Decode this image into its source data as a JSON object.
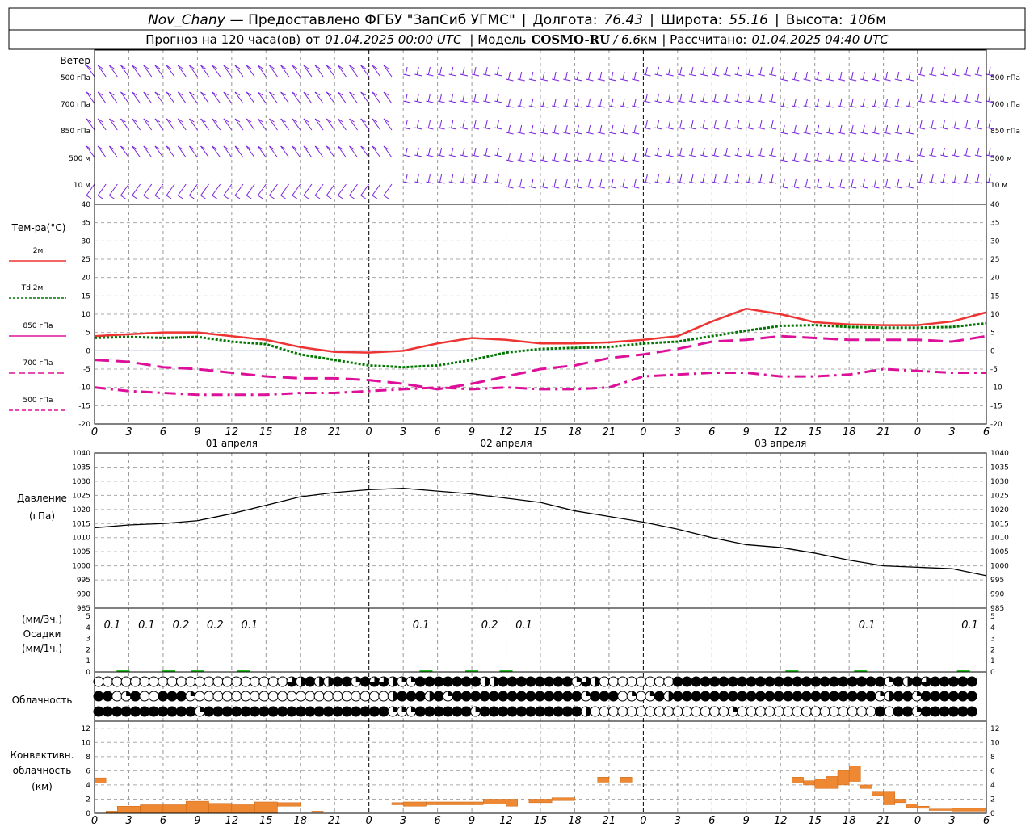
{
  "header": {
    "station": "Nov_Chany",
    "provider": "— Предоставлено ФГБУ \"ЗапСиб УГМС\"",
    "lon_label": "Долгота:",
    "lon_value": "76.43",
    "lat_label": "Широта:",
    "lat_value": "55.16",
    "alt_label": "Высота:",
    "alt_value": "106",
    "alt_unit": "м",
    "forecast_text": "Прогноз на 120 часа(ов)",
    "from_text": "от",
    "forecast_start": "01.04.2025 00:00 UTC",
    "model_label": "| Модель",
    "model_name": "COSMO-RU",
    "model_res": "/ 6.6",
    "model_res_unit": "км",
    "calc_label": "| Рассчитано:",
    "calc_time": "01.04.2025 04:40 UTC"
  },
  "x_axis": {
    "hour_labels": [
      "0",
      "3",
      "6",
      "9",
      "12",
      "15",
      "18",
      "21",
      "0",
      "3",
      "6",
      "9",
      "12",
      "15",
      "18",
      "21",
      "0",
      "3",
      "6",
      "9",
      "12",
      "15",
      "18",
      "21",
      "0",
      "3",
      "6"
    ],
    "day_labels": [
      "01 апреля",
      "02 апреля",
      "03 апреля"
    ]
  },
  "wind_panel": {
    "title": "Ветер",
    "levels": [
      "500 гПа",
      "700 гПа",
      "850 гПа",
      "500  м",
      "10   м"
    ]
  },
  "temperature_panel": {
    "title": "Тем-ра(°C)",
    "legend": [
      {
        "label": "2м",
        "color": "#ee3333",
        "style": "solid"
      },
      {
        "label": "Td  2м",
        "color": "#007700",
        "style": "dotted"
      },
      {
        "label": "850 гПа",
        "color": "#dd1199",
        "style": "long-dash"
      },
      {
        "label": "700 гПа",
        "color": "#dd1199",
        "style": "dash"
      },
      {
        "label": "500 гПа",
        "color": "#dd1199",
        "style": "dash-dot"
      }
    ],
    "y_ticks": [
      "40",
      "35",
      "30",
      "25",
      "20",
      "15",
      "10",
      "5",
      "0",
      "-5",
      "-10",
      "-15",
      "-20"
    ]
  },
  "pressure_panel": {
    "title": "Давление",
    "unit": "(гПа)",
    "y_ticks": [
      "1040",
      "1035",
      "1030",
      "1025",
      "1020",
      "1015",
      "1010",
      "1005",
      "1000",
      "995",
      "990",
      "985"
    ]
  },
  "precip_panel": {
    "unit_top": "(мм/3ч.)",
    "title": "Осадки",
    "unit_bottom": "(мм/1ч.)",
    "y_ticks": [
      "5",
      "4",
      "3",
      "2",
      "1",
      "0"
    ],
    "annotations": [
      {
        "hour": 0,
        "text": "0.1"
      },
      {
        "hour": 3,
        "text": "0.1"
      },
      {
        "hour": 6,
        "text": "0.2"
      },
      {
        "hour": 9,
        "text": "0.2"
      },
      {
        "hour": 12,
        "text": "0.1"
      },
      {
        "hour": 27,
        "text": "0.1"
      },
      {
        "hour": 33,
        "text": "0.2"
      },
      {
        "hour": 36,
        "text": "0.1"
      },
      {
        "hour": 66,
        "text": "0.1"
      },
      {
        "hour": 75,
        "text": "0.1"
      }
    ]
  },
  "cloud_panel": {
    "title": "Облачность"
  },
  "conv_panel": {
    "title_1": "Конвективн.",
    "title_2": "облачность",
    "unit": "(км)",
    "y_ticks": [
      "12",
      "10",
      "8",
      "6",
      "4",
      "2",
      "0"
    ]
  },
  "chart_data": {
    "type": "line",
    "x_unit": "hours from 01.04.2025 00:00 UTC",
    "x_range": [
      0,
      78
    ],
    "x": [
      0,
      3,
      6,
      9,
      12,
      15,
      18,
      21,
      24,
      27,
      30,
      33,
      36,
      39,
      42,
      45,
      48,
      51,
      54,
      57,
      60,
      63,
      66,
      69,
      72,
      75,
      78
    ],
    "temperature": {
      "ylim": [
        -20,
        40
      ],
      "series": [
        {
          "name": "2м",
          "values": [
            4,
            4.5,
            5,
            5,
            4,
            3,
            1,
            -0.3,
            -0.5,
            0,
            2,
            3.5,
            3,
            2,
            2,
            2.3,
            3,
            4,
            8,
            11.5,
            10,
            7.8,
            7.2,
            7,
            7,
            8,
            10.5
          ]
        },
        {
          "name": "Td  2м",
          "values": [
            3.5,
            3.8,
            3.5,
            3.8,
            2.5,
            1.8,
            -1,
            -2.5,
            -4,
            -4.5,
            -4,
            -2.5,
            -0.5,
            0.5,
            0.8,
            1,
            2,
            2.5,
            4,
            5.5,
            6.8,
            7,
            6.5,
            6.3,
            6.3,
            6.5,
            7.5
          ]
        },
        {
          "name": "850 гПа",
          "values": [
            -2.5,
            -3,
            -4.5,
            -5,
            -6,
            -7,
            -7.5,
            -7.5,
            -8,
            -9,
            -10.5,
            -9,
            -7,
            -5,
            -4,
            -2,
            -1,
            0.5,
            2.5,
            3,
            4,
            3.5,
            3,
            3,
            3,
            2.5,
            4
          ]
        },
        {
          "name": "700 гПа",
          "values": [
            -10,
            -11,
            -11.5,
            -12,
            -12,
            -12,
            -11.5,
            -11.5,
            -11,
            -10.5,
            -10,
            -10.5,
            -10,
            -10.5,
            -10.5,
            -10,
            -7,
            -6.5,
            -6,
            -6,
            -7,
            -7,
            -6.5,
            -5,
            -5.5,
            -6,
            -6
          ]
        }
      ]
    },
    "pressure": {
      "ylim": [
        985,
        1040
      ],
      "values": [
        1013.5,
        1014.5,
        1015,
        1016,
        1018.5,
        1021.5,
        1024.5,
        1026,
        1027,
        1027.5,
        1026.5,
        1025.5,
        1024,
        1022.5,
        1019.5,
        1017.5,
        1015.5,
        1013,
        1010,
        1007.5,
        1006.5,
        1004.5,
        1002,
        1000,
        999.5,
        999,
        996.5
      ]
    },
    "precipitation": {
      "ylim": [
        0,
        5
      ],
      "bars": [
        {
          "x": 2.5,
          "value": 0.15
        },
        {
          "x": 6.5,
          "value": 0.15
        },
        {
          "x": 9,
          "value": 0.2
        },
        {
          "x": 13,
          "value": 0.2
        },
        {
          "x": 29,
          "value": 0.05
        },
        {
          "x": 33,
          "value": 0.15
        },
        {
          "x": 36,
          "value": 0.2
        },
        {
          "x": 61,
          "value": 0.05
        },
        {
          "x": 67,
          "value": 0.15
        },
        {
          "x": 76,
          "value": 0.15
        }
      ]
    },
    "cloud_rows": [
      "000000000000000000000324224414332114444444224444444413200000000444444444444444444444441424344444",
      "440140044410000000000000000000002444241444444444444441444010142444444444444444444444412441444444",
      "444444444441444444444444444444441114444441444444444442000000000000000100000000000000040441444444"
    ],
    "convective": {
      "ylim": [
        0,
        13
      ],
      "bars": [
        {
          "from": 0,
          "to": 1,
          "base": 4.3,
          "top": 5
        },
        {
          "from": 1,
          "to": 2,
          "base": 0,
          "top": 0.3
        },
        {
          "from": 2,
          "to": 4,
          "base": 0,
          "top": 1
        },
        {
          "from": 4,
          "to": 6,
          "base": 0,
          "top": 1.2
        },
        {
          "from": 6,
          "to": 8,
          "base": 0,
          "top": 1.2
        },
        {
          "from": 8,
          "to": 10,
          "base": 0,
          "top": 1.7
        },
        {
          "from": 10,
          "to": 12,
          "base": 0,
          "top": 1.4
        },
        {
          "from": 12,
          "to": 14,
          "base": 0,
          "top": 1.2
        },
        {
          "from": 14,
          "to": 16,
          "base": 0,
          "top": 1.6
        },
        {
          "from": 16,
          "to": 18,
          "base": 1,
          "top": 1.5
        },
        {
          "from": 19,
          "to": 20,
          "base": 0.2,
          "top": 0.3
        },
        {
          "from": 26,
          "to": 27,
          "base": 1.2,
          "top": 1.5
        },
        {
          "from": 27,
          "to": 29,
          "base": 1,
          "top": 1.6
        },
        {
          "from": 29,
          "to": 34,
          "base": 1.2,
          "top": 1.6
        },
        {
          "from": 34,
          "to": 36,
          "base": 1.3,
          "top": 2
        },
        {
          "from": 36,
          "to": 37,
          "base": 1,
          "top": 2
        },
        {
          "from": 38,
          "to": 40,
          "base": 1.5,
          "top": 2
        },
        {
          "from": 40,
          "to": 42,
          "base": 1.8,
          "top": 2.2
        },
        {
          "from": 44,
          "to": 45,
          "base": 4.4,
          "top": 5.1
        },
        {
          "from": 46,
          "to": 47,
          "base": 4.4,
          "top": 5.1
        },
        {
          "from": 61,
          "to": 62,
          "base": 4.3,
          "top": 5.1
        },
        {
          "from": 62,
          "to": 63,
          "base": 4,
          "top": 4.6
        },
        {
          "from": 63,
          "to": 64,
          "base": 3.5,
          "top": 4.8
        },
        {
          "from": 64,
          "to": 65,
          "base": 3.5,
          "top": 5.2
        },
        {
          "from": 65,
          "to": 66,
          "base": 4,
          "top": 6
        },
        {
          "from": 66,
          "to": 67,
          "base": 4.5,
          "top": 6.7
        },
        {
          "from": 67,
          "to": 68,
          "base": 3.5,
          "top": 4
        },
        {
          "from": 68,
          "to": 69,
          "base": 2.5,
          "top": 3
        },
        {
          "from": 69,
          "to": 70,
          "base": 1.2,
          "top": 3
        },
        {
          "from": 70,
          "to": 71,
          "base": 1.5,
          "top": 2
        },
        {
          "from": 71,
          "to": 72,
          "base": 0.8,
          "top": 1.3
        },
        {
          "from": 72,
          "to": 73,
          "base": 0.7,
          "top": 1
        },
        {
          "from": 73,
          "to": 75,
          "base": 0.4,
          "top": 0.6
        },
        {
          "from": 75,
          "to": 78,
          "base": 0.3,
          "top": 0.7
        }
      ]
    },
    "wind_levels": [
      "500 гПа",
      "700 гПа",
      "850 гПа",
      "500  м",
      "10   м"
    ]
  },
  "colors": {
    "wind": "#7722dd",
    "t2m": "#ee3333",
    "td2m": "#007700",
    "upper": "#dd1199",
    "zero_line": "#3344cc",
    "precip": "#22bb22",
    "conv": "#ee8833",
    "pressure": "#000000"
  }
}
